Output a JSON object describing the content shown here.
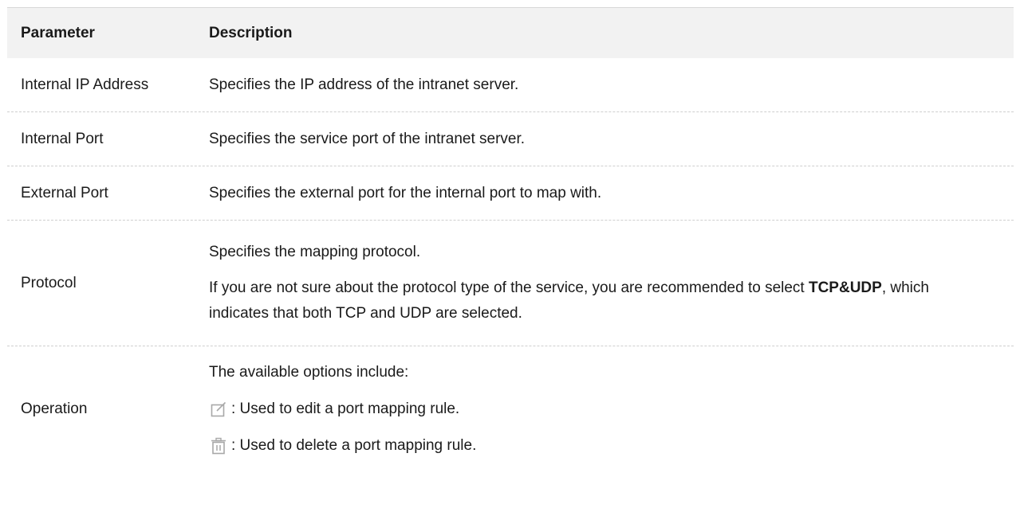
{
  "table": {
    "headers": {
      "parameter": "Parameter",
      "description": "Description"
    },
    "rows": [
      {
        "parameter": "Internal IP Address",
        "description": "Specifies the IP address of the intranet server."
      },
      {
        "parameter": "Internal Port",
        "description": "Specifies the service port of the intranet server."
      },
      {
        "parameter": "External Port",
        "description": "Specifies the external port for the internal port to map with."
      },
      {
        "parameter": "Protocol",
        "description_lines": [
          "Specifies the mapping protocol.",
          {
            "before": "If you are not sure about the protocol type of the service, you are recommended to select ",
            "bold": "TCP&UDP",
            "after": ", which indicates that both TCP and UDP are selected."
          }
        ]
      },
      {
        "parameter": "Operation",
        "intro": "The available options include:",
        "options": [
          {
            "icon": "edit-icon",
            "text": ": Used to edit a port mapping rule."
          },
          {
            "icon": "delete-icon",
            "text": ": Used to delete a port mapping rule."
          }
        ]
      }
    ]
  },
  "colors": {
    "header_bg": "#f2f2f2",
    "divider": "#cfcfcf",
    "icon_gray": "#a8a8a8"
  }
}
